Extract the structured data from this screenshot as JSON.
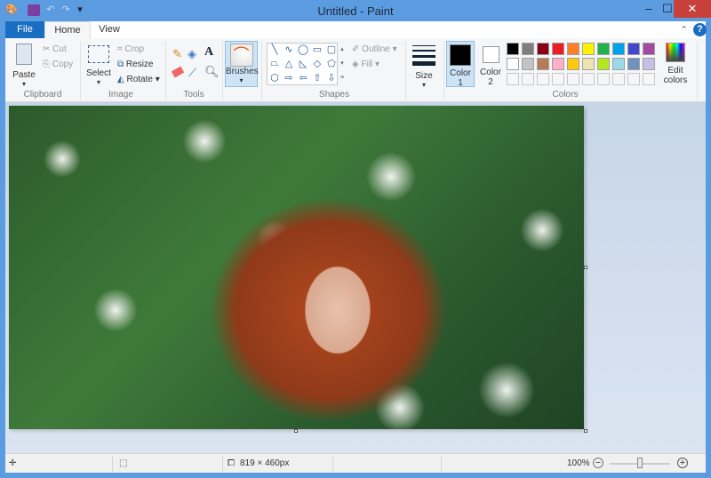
{
  "window": {
    "title": "Untitled - Paint",
    "minimize": "–",
    "maximize": "☐",
    "close": "✕"
  },
  "quick_access": [
    "paint-icon",
    "save-icon",
    "undo-icon",
    "redo-icon",
    "customize-icon"
  ],
  "tabs": [
    {
      "label": "File"
    },
    {
      "label": "Home"
    },
    {
      "label": "View"
    }
  ],
  "ribbon": {
    "clipboard": {
      "paste": "Paste",
      "cut": "Cut",
      "copy": "Copy",
      "group": "Clipboard"
    },
    "image": {
      "select": "Select",
      "crop": "Crop",
      "resize": "Resize",
      "rotate": "Rotate",
      "group": "Image"
    },
    "tools": {
      "group": "Tools"
    },
    "brushes": {
      "label": "Brushes"
    },
    "shapes": {
      "outline": "Outline",
      "fill": "Fill",
      "group": "Shapes",
      "glyphs": [
        "╲",
        "∿",
        "◯",
        "▭",
        "▢",
        "⏢",
        "△",
        "◺",
        "◇",
        "⬠",
        "⬡",
        "⇨",
        "⇦",
        "⇧",
        "⇩"
      ]
    },
    "size": {
      "label": "Size"
    },
    "color1": {
      "label": "Color",
      "num": "1",
      "value": "#000000"
    },
    "color2": {
      "label": "Color",
      "num": "2",
      "value": "#ffffff"
    },
    "palette": {
      "row1": [
        "#000000",
        "#7f7f7f",
        "#880015",
        "#ed1c24",
        "#ff7f27",
        "#fff200",
        "#22b14c",
        "#00a2e8",
        "#3f48cc",
        "#a349a4"
      ],
      "row2": [
        "#ffffff",
        "#c3c3c3",
        "#b97a57",
        "#ffaec9",
        "#ffc90e",
        "#efe4b0",
        "#b5e61d",
        "#99d9ea",
        "#7092be",
        "#c8bfe7"
      ]
    },
    "colors_group": "Colors",
    "edit_colors": {
      "line1": "Edit",
      "line2": "colors"
    }
  },
  "status": {
    "image_size": "819 × 460px",
    "zoom": "100%",
    "zoom_level_percent": 100
  }
}
